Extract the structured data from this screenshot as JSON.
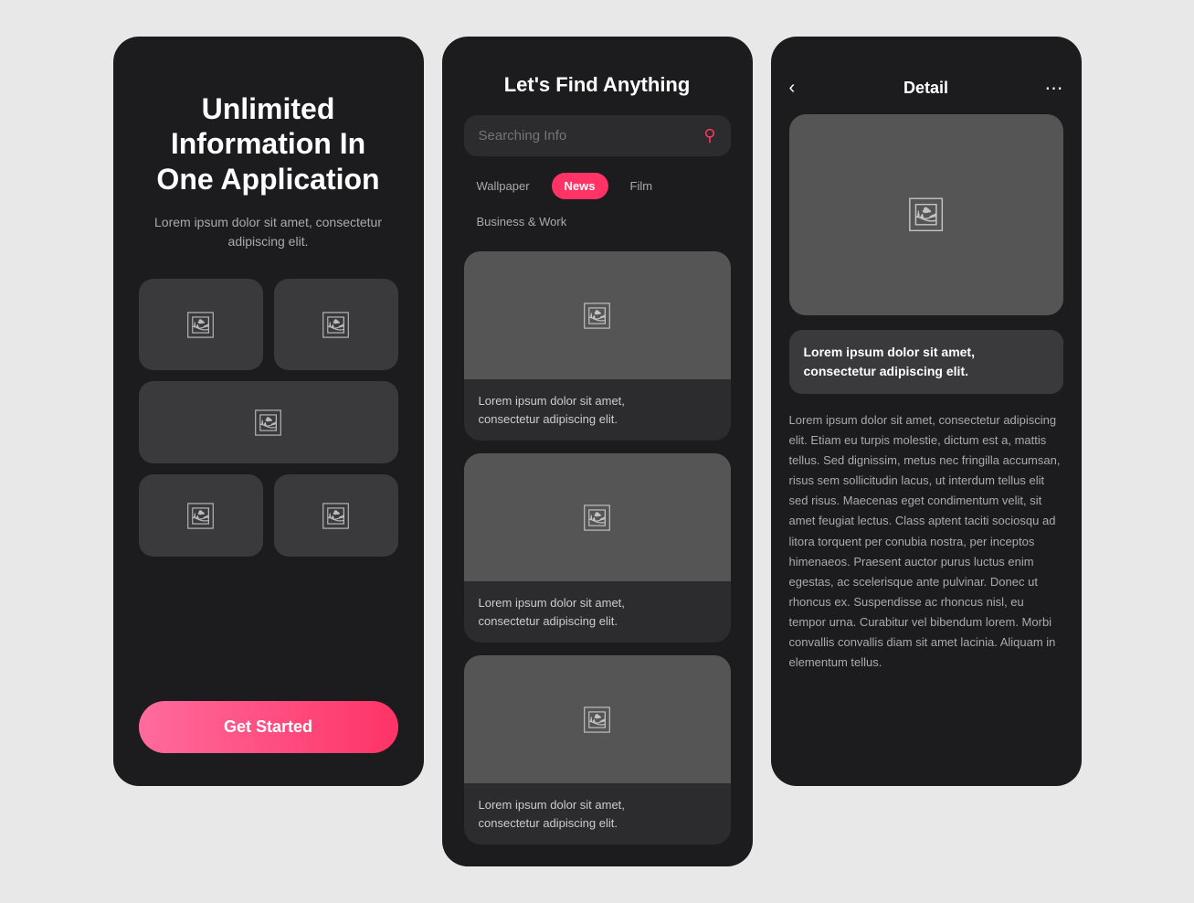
{
  "screen1": {
    "headline": "Unlimited Information In One Application",
    "subtitle": "Lorem ipsum dolor sit amet, consectetur adipiscing elit.",
    "get_started": "Get Started"
  },
  "screen2": {
    "title": "Let's Find Anything",
    "search_placeholder": "Searching Info",
    "filters": [
      {
        "label": "Wallpaper",
        "active": false
      },
      {
        "label": "News",
        "active": true
      },
      {
        "label": "Film",
        "active": false
      },
      {
        "label": "Business & Work",
        "active": false
      }
    ],
    "cards": [
      {
        "text": "Lorem ipsum dolor sit amet, consectetur adipiscing elit."
      },
      {
        "text": "Lorem ipsum dolor sit amet, consectetur adipiscing elit."
      },
      {
        "text": "Lorem ipsum dolor sit amet, consectetur adipiscing elit."
      }
    ]
  },
  "screen3": {
    "header_title": "Detail",
    "caption": "Lorem ipsum dolor sit amet, consectetur adipiscing elit.",
    "body": "Lorem ipsum dolor sit amet, consectetur adipiscing elit. Etiam eu turpis molestie, dictum est a, mattis tellus. Sed dignissim, metus nec fringilla accumsan, risus sem sollicitudin lacus, ut interdum tellus elit sed risus. Maecenas eget condimentum velit, sit amet feugiat lectus. Class aptent taciti sociosqu ad litora torquent per conubia nostra, per inceptos himenaeos. Praesent auctor purus luctus enim egestas, ac scelerisque ante pulvinar. Donec ut rhoncus ex. Suspendisse ac rhoncus nisl, eu tempor urna. Curabitur vel bibendum lorem. Morbi convallis convallis diam sit amet lacinia. Aliquam in elementum tellus."
  }
}
